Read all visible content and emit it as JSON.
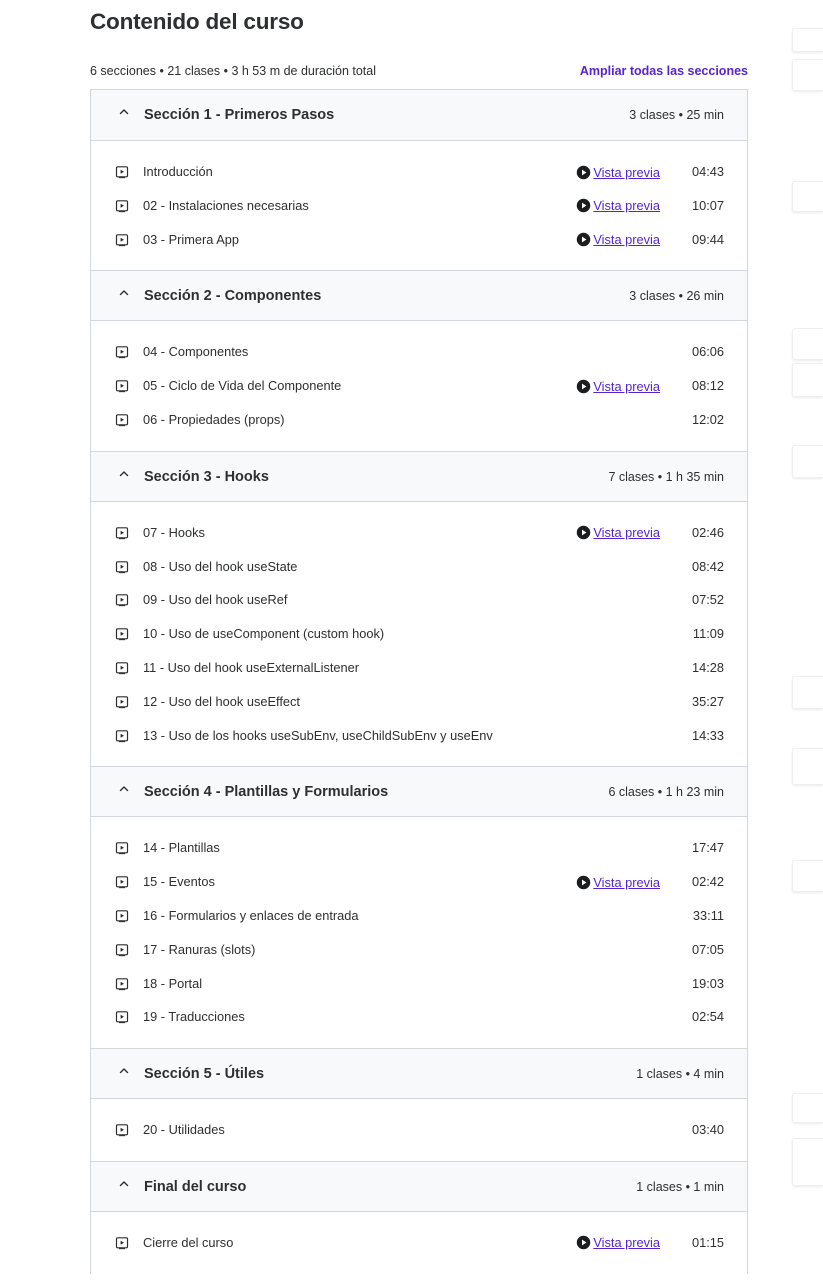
{
  "page": {
    "title": "Contenido del curso",
    "meta": "6 secciones • 21 clases • 3 h 53 m de duración total",
    "expand_all": "Ampliar todas las secciones"
  },
  "preview_label": "Vista previa",
  "colors": {
    "accent": "#5624d0",
    "text": "#2d2f31",
    "header_bg": "#f7f9fa",
    "border": "#d1d7dc"
  },
  "icons": {
    "section_toggle": "chevron-up-icon",
    "lecture": "video-icon",
    "preview": "play-circle-icon"
  },
  "sections": [
    {
      "title": "Sección 1 - Primeros Pasos",
      "info": "3 clases • 25 min",
      "lectures": [
        {
          "title": "Introducción",
          "preview": true,
          "duration": "04:43"
        },
        {
          "title": "02 - Instalaciones necesarias",
          "preview": true,
          "duration": "10:07"
        },
        {
          "title": "03 - Primera App",
          "preview": true,
          "duration": "09:44"
        }
      ]
    },
    {
      "title": "Sección 2 - Componentes",
      "info": "3 clases • 26 min",
      "lectures": [
        {
          "title": "04 - Componentes",
          "preview": false,
          "duration": "06:06"
        },
        {
          "title": "05 - Ciclo de Vida del Componente",
          "preview": true,
          "duration": "08:12"
        },
        {
          "title": "06 - Propiedades (props)",
          "preview": false,
          "duration": "12:02"
        }
      ]
    },
    {
      "title": "Sección 3 - Hooks",
      "info": "7 clases • 1 h 35 min",
      "lectures": [
        {
          "title": "07 - Hooks",
          "preview": true,
          "duration": "02:46"
        },
        {
          "title": "08 - Uso del hook useState",
          "preview": false,
          "duration": "08:42"
        },
        {
          "title": "09 - Uso del hook useRef",
          "preview": false,
          "duration": "07:52"
        },
        {
          "title": "10 - Uso de useComponent (custom hook)",
          "preview": false,
          "duration": "11:09"
        },
        {
          "title": "11 - Uso del hook useExternalListener",
          "preview": false,
          "duration": "14:28"
        },
        {
          "title": "12 - Uso del hook useEffect",
          "preview": false,
          "duration": "35:27"
        },
        {
          "title": "13 - Uso de los hooks useSubEnv, useChildSubEnv y useEnv",
          "preview": false,
          "duration": "14:33"
        }
      ]
    },
    {
      "title": "Sección 4 - Plantillas y Formularios",
      "info": "6 clases • 1 h 23 min",
      "lectures": [
        {
          "title": "14 - Plantillas",
          "preview": false,
          "duration": "17:47"
        },
        {
          "title": "15 - Eventos",
          "preview": true,
          "duration": "02:42"
        },
        {
          "title": "16 - Formularios y enlaces de entrada",
          "preview": false,
          "duration": "33:11"
        },
        {
          "title": "17 - Ranuras (slots)",
          "preview": false,
          "duration": "07:05"
        },
        {
          "title": "18 - Portal",
          "preview": false,
          "duration": "19:03"
        },
        {
          "title": "19 - Traducciones",
          "preview": false,
          "duration": "02:54"
        }
      ]
    },
    {
      "title": "Sección 5 - Útiles",
      "info": "1 clases • 4 min",
      "lectures": [
        {
          "title": "20 - Utilidades",
          "preview": false,
          "duration": "03:40"
        }
      ]
    },
    {
      "title": "Final del curso",
      "info": "1 clases • 1 min",
      "lectures": [
        {
          "title": "Cierre del curso",
          "preview": true,
          "duration": "01:15"
        }
      ]
    }
  ]
}
